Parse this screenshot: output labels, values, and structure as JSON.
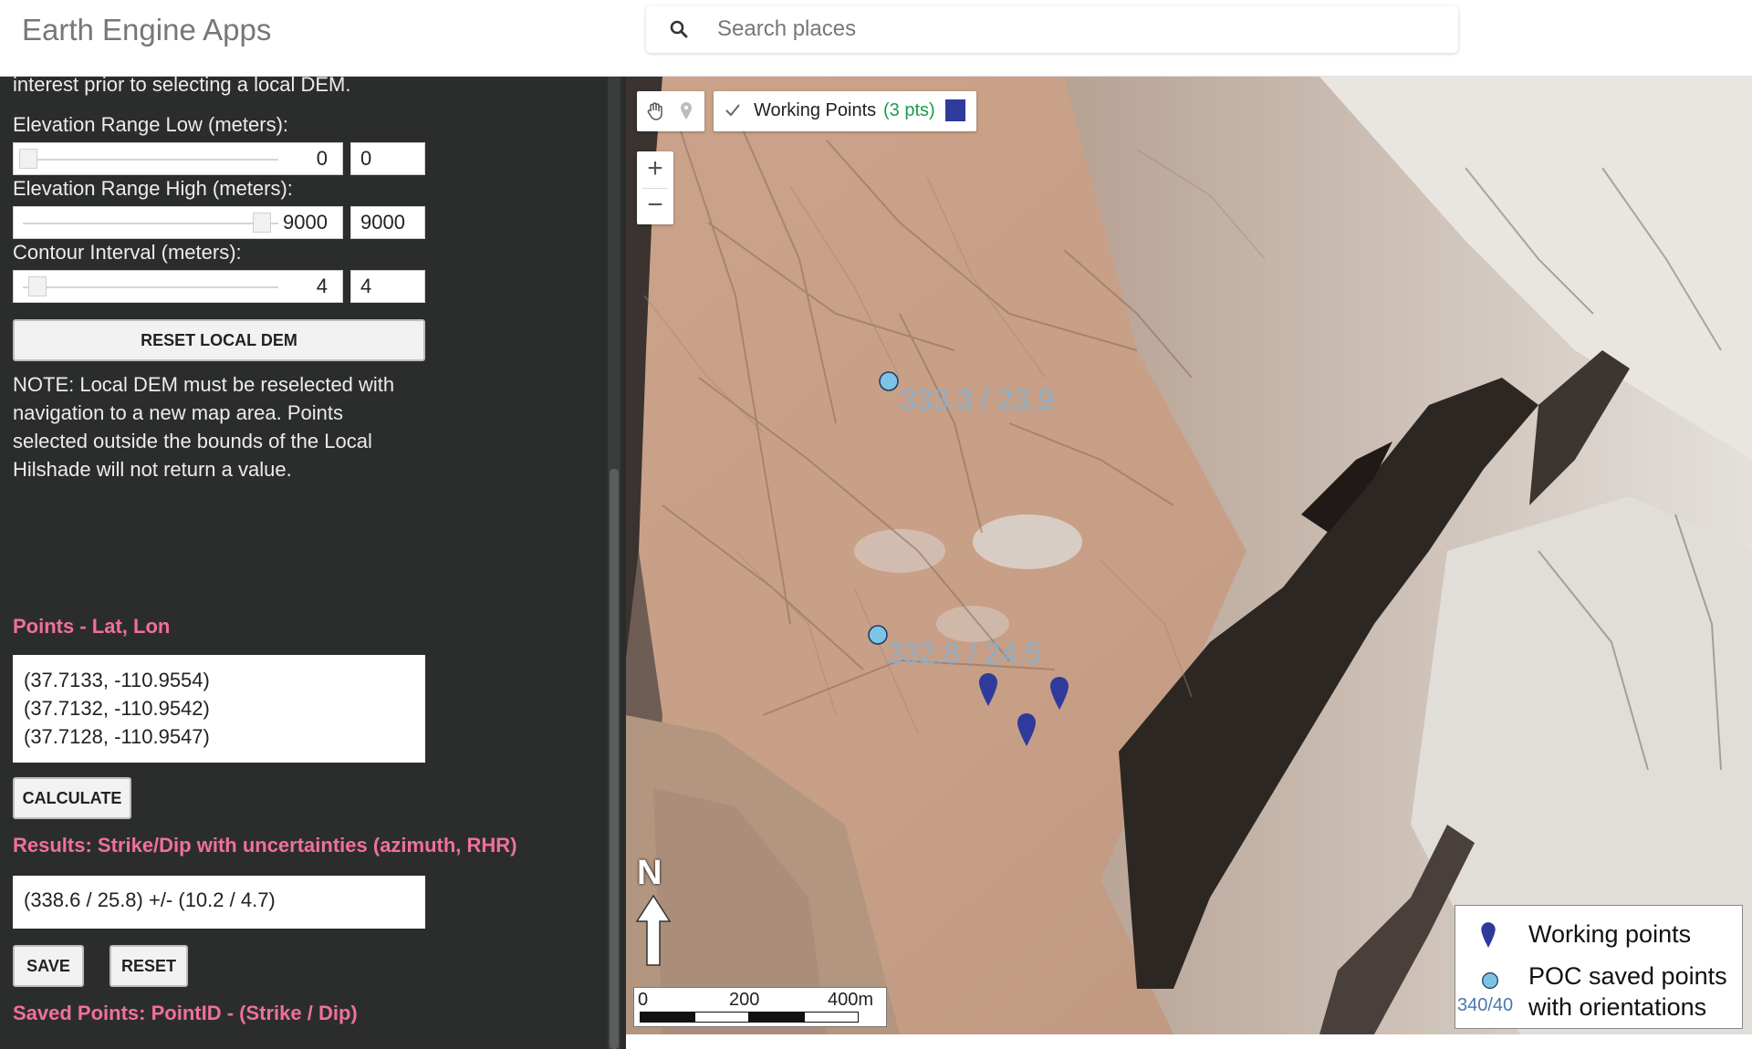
{
  "header": {
    "app_title": "Earth Engine Apps",
    "search_placeholder": "Search places"
  },
  "panel": {
    "intro_text": "interest prior to selecting a local DEM.",
    "elev_low": {
      "label": "Elevation Range Low (meters):",
      "value": "0",
      "field": "0",
      "fraction": 0.0
    },
    "elev_high": {
      "label": "Elevation Range High (meters):",
      "value": "9000",
      "field": "9000",
      "fraction": 1.0
    },
    "contour": {
      "label": "Contour Interval (meters):",
      "value": "4",
      "field": "4",
      "fraction": 0.04
    },
    "reset_dem_label": "RESET LOCAL DEM",
    "note_lines": [
      "NOTE: Local DEM must be reselected with",
      "navigation to a new map area. Points",
      "selected outside the bounds of the Local",
      "Hilshade will not return a value."
    ],
    "points_label": "Points - Lat, Lon",
    "points": [
      "(37.7133, -110.9554)",
      "(37.7132, -110.9542)",
      "(37.7128, -110.9547)"
    ],
    "calculate_label": "CALCULATE",
    "results_label": "Results: Strike/Dip with uncertainties (azimuth, RHR)",
    "result_value": "(338.6 / 25.8) +/- (10.2 / 4.7)",
    "save_label": "SAVE",
    "reset_label": "RESET",
    "saved_label": "Saved Points: PointID - (Strike / Dip)"
  },
  "map": {
    "layer_name": "Working Points",
    "layer_count": "(3 pts)",
    "layer_checked": true,
    "layer_color": "#2f3a9b",
    "zoom_in": "+",
    "zoom_out": "−",
    "poc_points": [
      {
        "label": "333.3 / 23.9"
      },
      {
        "label": "332.8 / 24.5"
      }
    ],
    "north_label": "N",
    "scale": {
      "tick0": "0",
      "tick1": "200",
      "tick2": "400m"
    },
    "legend": {
      "working_label": "Working points",
      "poc_line1": "POC saved points",
      "poc_line2": "with orientations",
      "poc_example": "340/40"
    },
    "colors": {
      "marker": "#2f3a9b",
      "poc": "#7cc3e6",
      "accent_pink": "#f0709a"
    }
  }
}
